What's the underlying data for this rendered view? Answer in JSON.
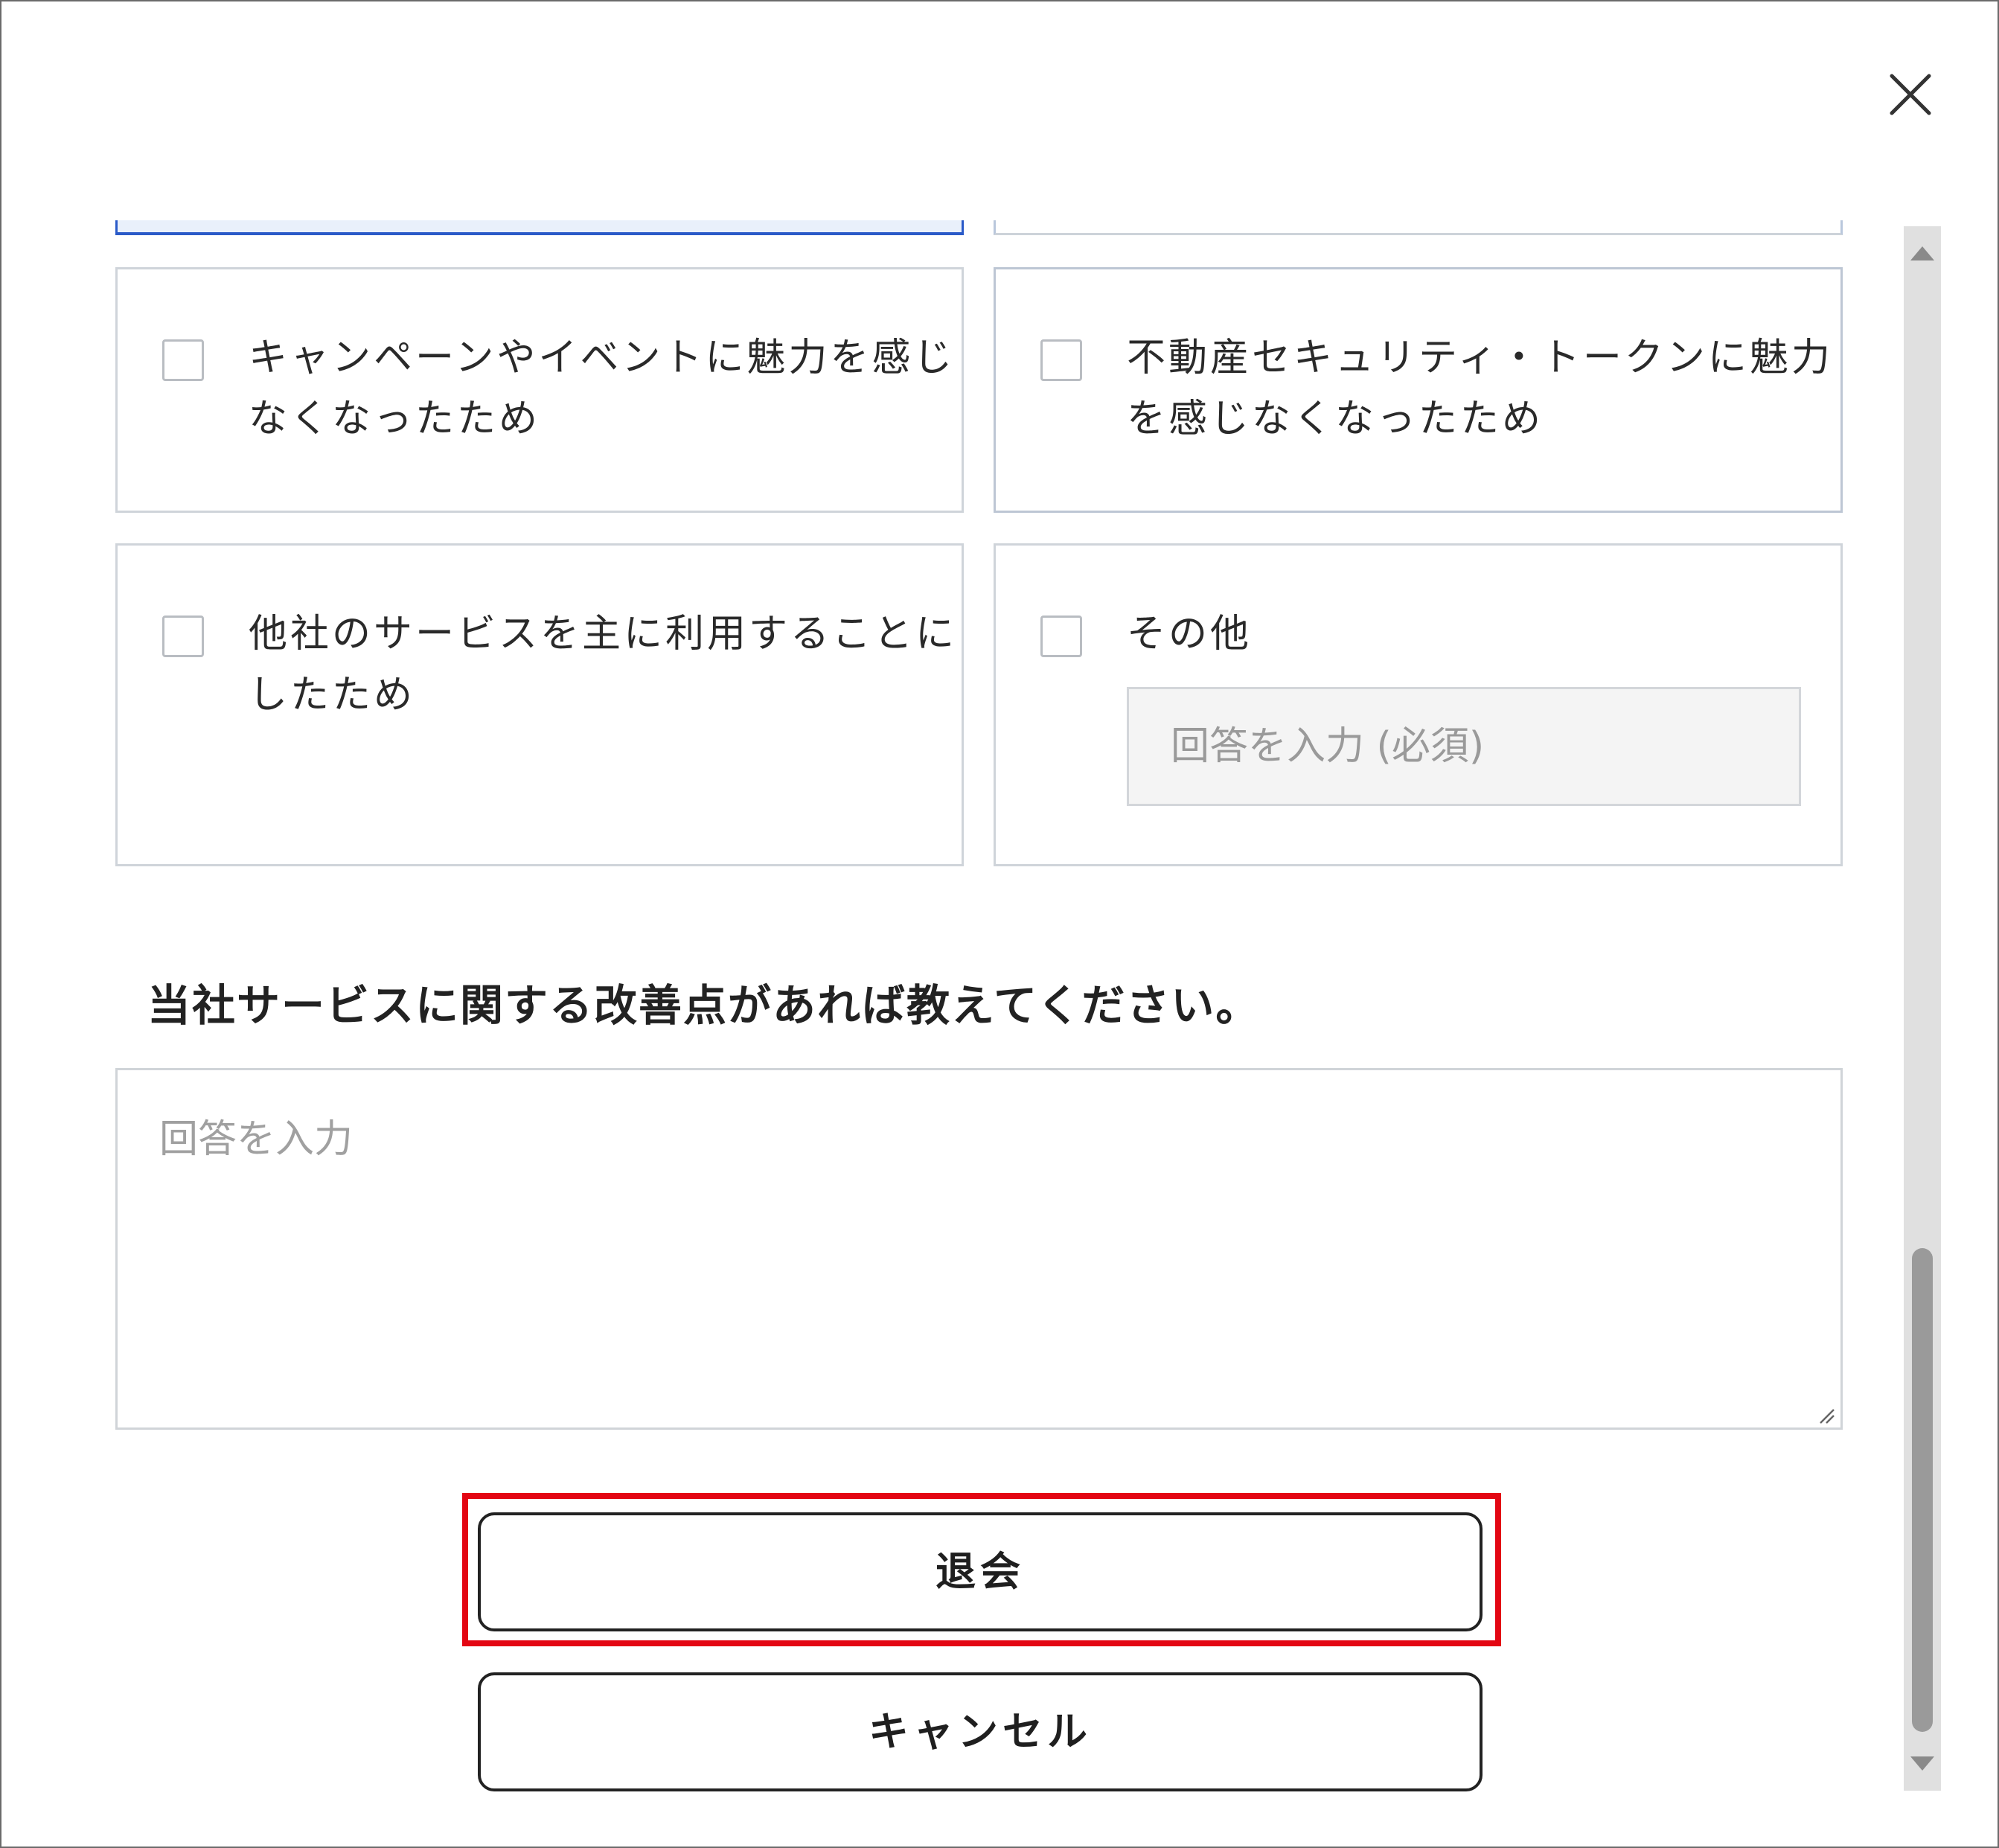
{
  "dialog": {
    "close_icon": "close-icon"
  },
  "options": [
    {
      "label": "キャンペーンやイベントに魅力を感じなくなったため",
      "checked": false
    },
    {
      "label": "不動産セキュリティ・トークンに魅力を感じなくなったため",
      "checked": false
    },
    {
      "label": "他社のサービスを主に利用することにしたため",
      "checked": false
    },
    {
      "label": "その他",
      "checked": false,
      "input_placeholder": "回答を入力 (必須)",
      "input_value": ""
    }
  ],
  "improvement": {
    "question": "当社サービスに関する改善点があれば教えてください。",
    "placeholder": "回答を入力",
    "value": ""
  },
  "buttons": {
    "withdraw_label": "退会",
    "cancel_label": "キャンセル"
  },
  "colors": {
    "highlight": "#e30613",
    "selected_border": "#2a5ac8"
  }
}
